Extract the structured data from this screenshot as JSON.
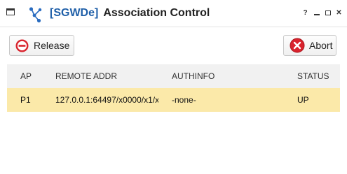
{
  "titlebar": {
    "prefix": "[SGWDe]",
    "title": "Association Control",
    "icons": {
      "window_menu": "window-menu-icon",
      "app": "network-node-icon",
      "help": "help-icon",
      "minimize": "minimize-icon",
      "maximize": "maximize-icon",
      "close": "close-icon"
    },
    "help_label": "?"
  },
  "toolbar": {
    "release_label": "Release",
    "release_icon": "no-entry-icon",
    "abort_label": "Abort",
    "abort_icon": "abort-x-icon"
  },
  "table": {
    "columns": [
      "AP",
      "REMOTE ADDR",
      "AUTHINFO",
      "STATUS"
    ],
    "rows": [
      {
        "ap": "P1",
        "remote_addr": "127.0.0.1:64497/x0000/x1/x",
        "authinfo": "-none-",
        "status": "UP"
      }
    ],
    "selected_row_color": "#fbe9a9"
  },
  "colors": {
    "title_prefix": "#1f5fa8",
    "release_icon": "#d9232d",
    "abort_icon": "#d9232d"
  }
}
